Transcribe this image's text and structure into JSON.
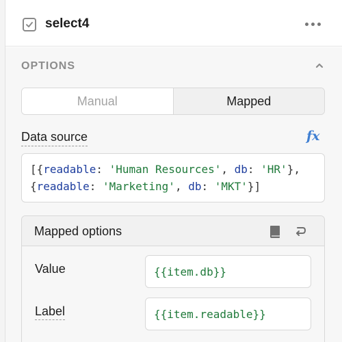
{
  "header": {
    "component_name": "select4",
    "more_icon": "more-horizontal-icon",
    "check_icon": "checkbox-icon"
  },
  "options_section": {
    "title": "OPTIONS",
    "collapse_icon": "chevron-up-icon",
    "mode_toggle": {
      "options": [
        "Manual",
        "Mapped"
      ],
      "selected": "Mapped"
    },
    "data_source": {
      "label": "Data source",
      "fx_label": "fx",
      "line1": {
        "open": "[{",
        "k1": "readable",
        "sep1": ": ",
        "v1": "'Human Resources'",
        "sep2": ", ",
        "k2": "db",
        "sep3": ": ",
        "v2": "'HR'",
        "close": "},"
      },
      "line2": {
        "open": "{",
        "k1": "readable",
        "sep1": ": ",
        "v1": "'Marketing'",
        "sep2": ", ",
        "k2": "db",
        "sep3": ": ",
        "v2": "'MKT'",
        "close": "}]"
      }
    },
    "mapped_options": {
      "title": "Mapped options",
      "book_icon": "docs-book-icon",
      "reset_icon": "reset-icon",
      "value_label": "Value",
      "value": "{{item.db}}",
      "label_label": "Label",
      "label_value": "{{item.readable}}"
    }
  },
  "colors": {
    "accent_fx": "#3f7fd2",
    "code_key": "#1d3d9e",
    "code_string": "#1f7a3a"
  }
}
